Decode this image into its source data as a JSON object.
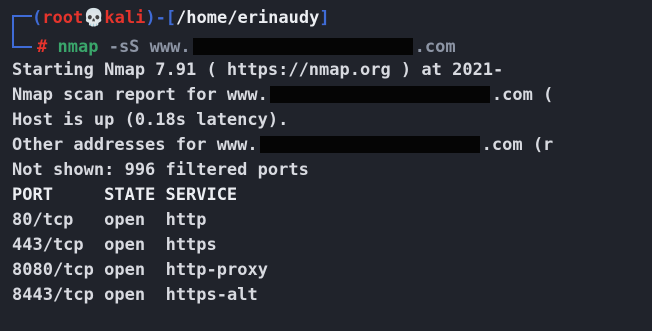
{
  "prompt": {
    "open_paren": "(",
    "user": "root",
    "skull": "💀",
    "host": "kali",
    "close_paren": ")-[",
    "path": "/home/erinaudy",
    "close_bracket": "]",
    "hash": "#",
    "command": "nmap",
    "flag": "-sS",
    "target_prefix": "www.",
    "target_suffix": ".com"
  },
  "output": {
    "starting": "Starting Nmap 7.91 ( https://nmap.org ) at 2021-",
    "scan_report_prefix": "Nmap scan report for www.",
    "scan_report_suffix": ".com (",
    "host_up": "Host is up (0.18s latency).",
    "other_prefix": "Other addresses for www.",
    "other_suffix": ".com (r",
    "not_shown": "Not shown: 996 filtered ports",
    "table_header": "PORT     STATE SERVICE"
  },
  "ports": [
    {
      "port": "80/tcp",
      "state": "open",
      "service": "http"
    },
    {
      "port": "443/tcp",
      "state": "open",
      "service": "https"
    },
    {
      "port": "8080/tcp",
      "state": "open",
      "service": "http-proxy"
    },
    {
      "port": "8443/tcp",
      "state": "open",
      "service": "https-alt"
    }
  ],
  "colors": {
    "background": "#20232b",
    "prompt_blue": "#3f6bd6",
    "prompt_red": "#e5342c",
    "text": "#d8dae0"
  }
}
